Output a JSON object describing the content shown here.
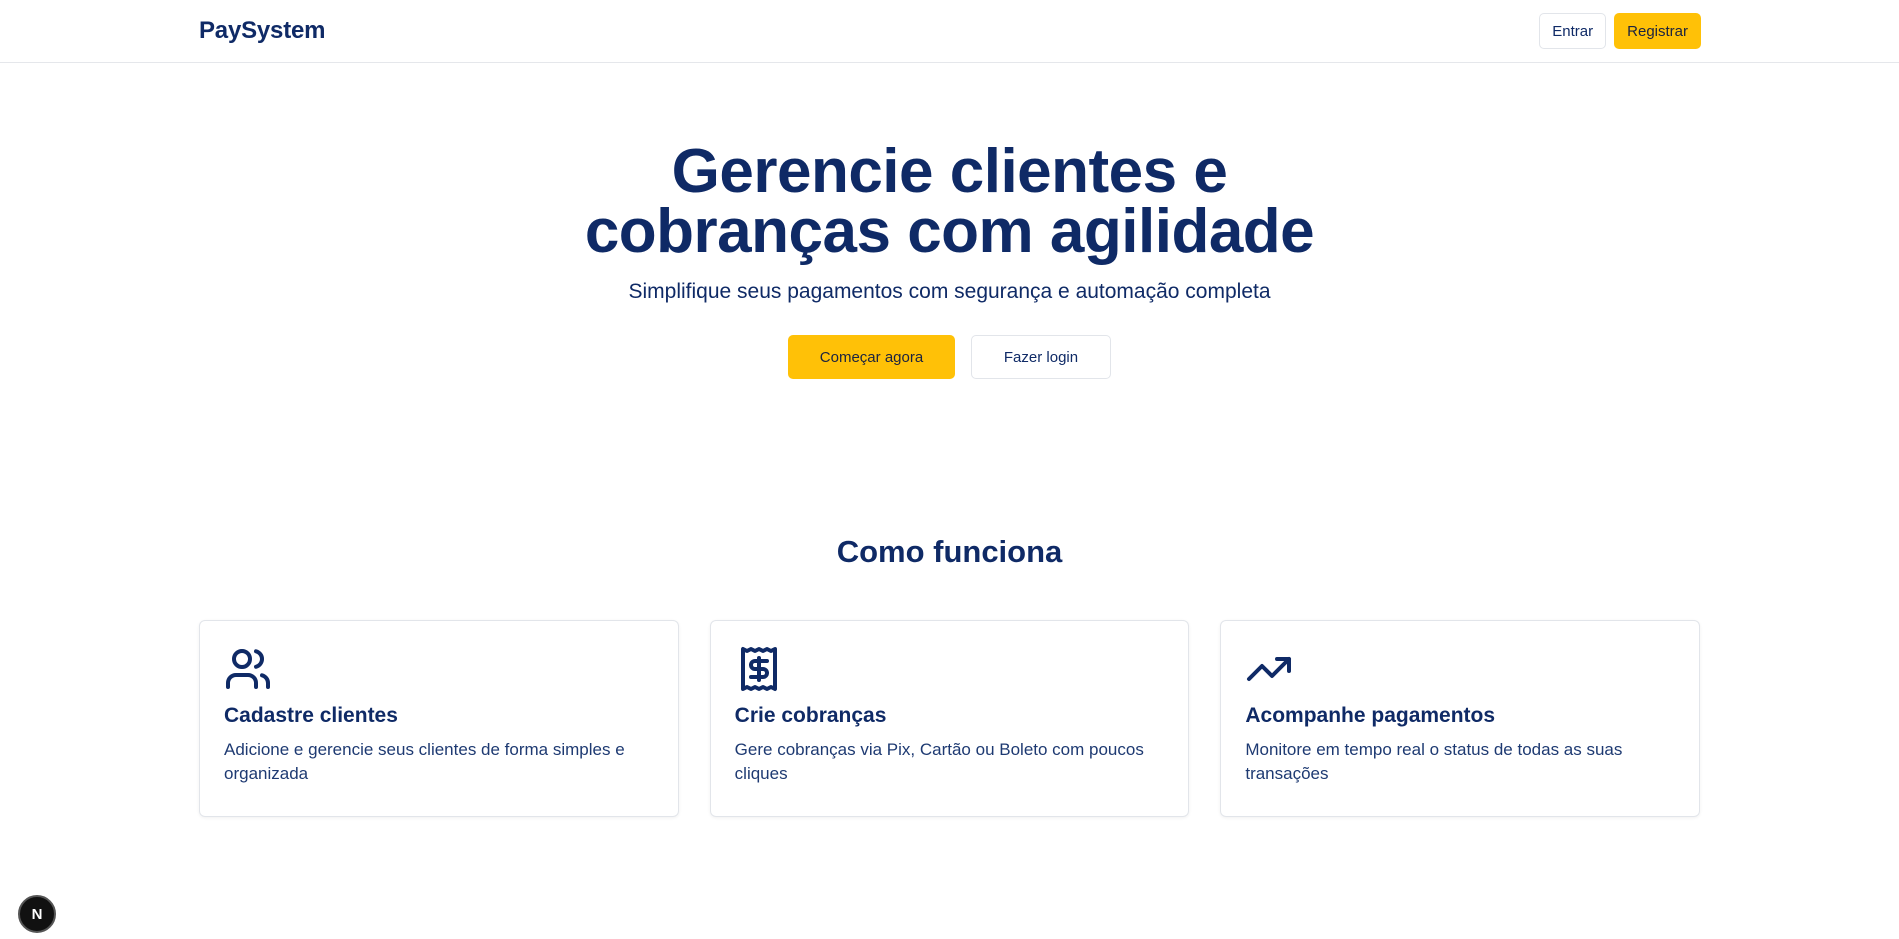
{
  "header": {
    "brand": "PaySystem",
    "login_label": "Entrar",
    "register_label": "Registrar"
  },
  "hero": {
    "title_line1": "Gerencie clientes e",
    "title_line2": "cobranças com agilidade",
    "subtitle": "Simplifique seus pagamentos com segurança e automação completa",
    "primary_cta": "Começar agora",
    "secondary_cta": "Fazer login"
  },
  "how_it_works": {
    "heading": "Como funciona",
    "cards": [
      {
        "icon": "users-icon",
        "title": "Cadastre clientes",
        "description": "Adicione e gerencie seus clientes de forma simples e organizada"
      },
      {
        "icon": "receipt-dollar-icon",
        "title": "Crie cobranças",
        "description": "Gere cobranças via Pix, Cartão ou Boleto com poucos cliques"
      },
      {
        "icon": "trending-up-icon",
        "title": "Acompanhe pagamentos",
        "description": "Monitore em tempo real o status de todas as suas transações"
      }
    ]
  },
  "dev_badge": {
    "label": "N"
  },
  "colors": {
    "primary_navy": "#0f2a66",
    "accent_yellow": "#ffc107",
    "border": "#e2e5ea"
  }
}
